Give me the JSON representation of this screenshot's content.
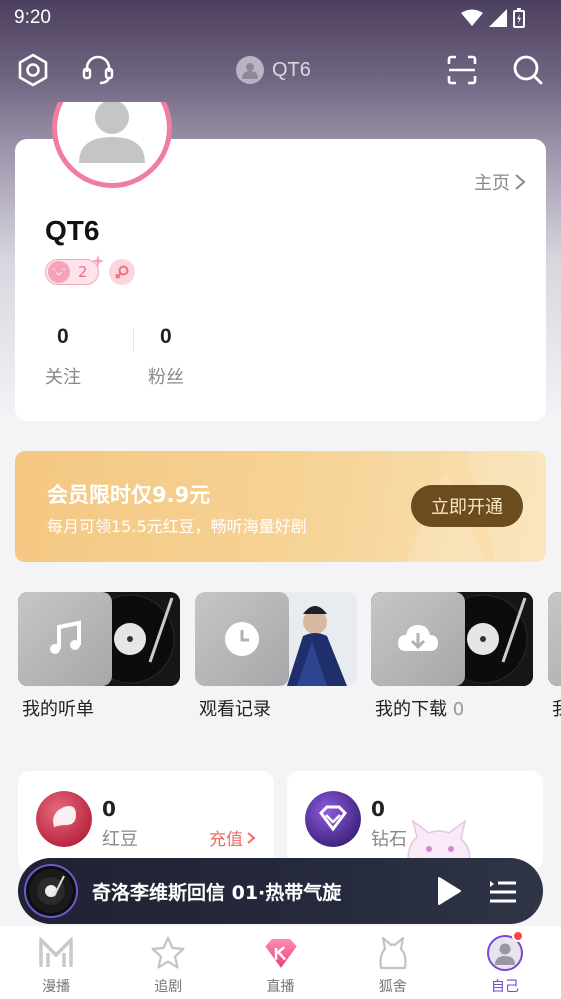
{
  "status_bar": {
    "time": "9:20"
  },
  "top_nav": {
    "username": "QT6"
  },
  "profile": {
    "home_link": "主页",
    "username": "QT6",
    "level": "2",
    "stats": [
      {
        "value": "0",
        "label": "关注"
      },
      {
        "value": "0",
        "label": "粉丝"
      }
    ]
  },
  "vip_banner": {
    "title": "会员限时仅9.9元",
    "subtitle": "每月可领15.5元红豆，畅听海量好剧",
    "button": "立即开通"
  },
  "shortcuts": [
    {
      "label": "我的听单",
      "icon": "music-note-icon"
    },
    {
      "label": "观看记录",
      "icon": "clock-icon"
    },
    {
      "label": "我的下载",
      "count": "0",
      "icon": "download-icon"
    },
    {
      "label": "我"
    }
  ],
  "wallet": {
    "hongdou": {
      "value": "0",
      "name": "红豆",
      "action": "充值"
    },
    "zuanshi": {
      "value": "0",
      "name": "钻石"
    }
  },
  "player": {
    "title": "奇洛李维斯回信 01·热带气旋"
  },
  "bottom_nav": [
    {
      "label": "漫播",
      "icon": "manbo-logo-icon"
    },
    {
      "label": "追剧",
      "icon": "star-icon"
    },
    {
      "label": "直播",
      "icon": "diamond-live-icon"
    },
    {
      "label": "狐舍",
      "icon": "fox-icon"
    },
    {
      "label": "自己",
      "icon": "profile-avatar-icon",
      "active": true
    }
  ],
  "colors": {
    "accent": "#7a47d6",
    "avatar_ring": "#f07ea0",
    "vip_button": "#6b4c1f",
    "recharge": "#f26a6a"
  }
}
